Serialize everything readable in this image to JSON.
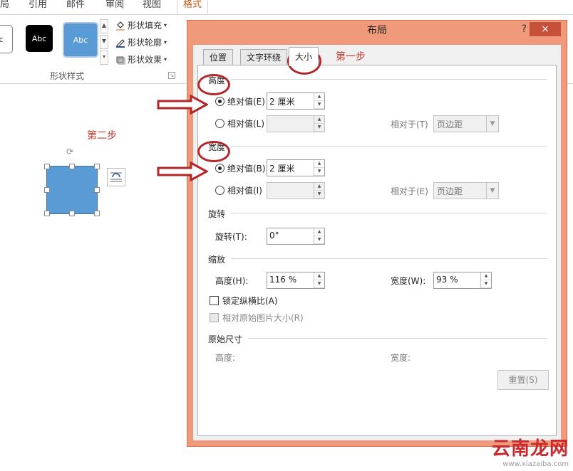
{
  "ribbon": {
    "tabs": [
      "局",
      "引用",
      "邮件",
      "审阅",
      "视图",
      "格式"
    ],
    "active_tab": "格式",
    "swatches": [
      "bc",
      "Abc",
      "Abc"
    ],
    "commands": [
      "形状填充",
      "形状轮廓",
      "形状效果"
    ],
    "group_label": "形状样式"
  },
  "canvas": {
    "step2_label": "第二步"
  },
  "dialog": {
    "title": "布局",
    "help": "?",
    "close": "×",
    "tabs": [
      "位置",
      "文字环绕",
      "大小"
    ],
    "active_tab": "大小",
    "step1_label": "第一步",
    "height_section": "高度",
    "height_absolute_label": "绝对值(E)",
    "height_absolute_value": "2 厘米",
    "height_relative_label": "相对值(L)",
    "height_relative_to_label": "相对于(T)",
    "height_relative_to_value": "页边距",
    "width_section": "宽度",
    "width_absolute_label": "绝对值(B)",
    "width_absolute_value": "2 厘米",
    "width_relative_label": "相对值(I)",
    "width_relative_to_label": "相对于(E)",
    "width_relative_to_value": "页边距",
    "rotation_section": "旋转",
    "rotation_label": "旋转(T):",
    "rotation_value": "0°",
    "scale_section": "缩放",
    "scale_height_label": "高度(H):",
    "scale_height_value": "116 %",
    "scale_width_label": "宽度(W):",
    "scale_width_value": "93 %",
    "lock_aspect_label": "锁定纵横比(A)",
    "relative_original_label": "相对原始图片大小(R)",
    "original_section": "原始尺寸",
    "original_height_label": "高度:",
    "original_width_label": "宽度:",
    "reset_button": "重置(S)"
  },
  "watermark": {
    "brand": "云南龙网",
    "url": "www.xiazaiba.com"
  },
  "colors": {
    "annotation_red": "#b3272b",
    "dialog_frame": "#f09a7b",
    "shape_fill": "#5b9bd5"
  }
}
